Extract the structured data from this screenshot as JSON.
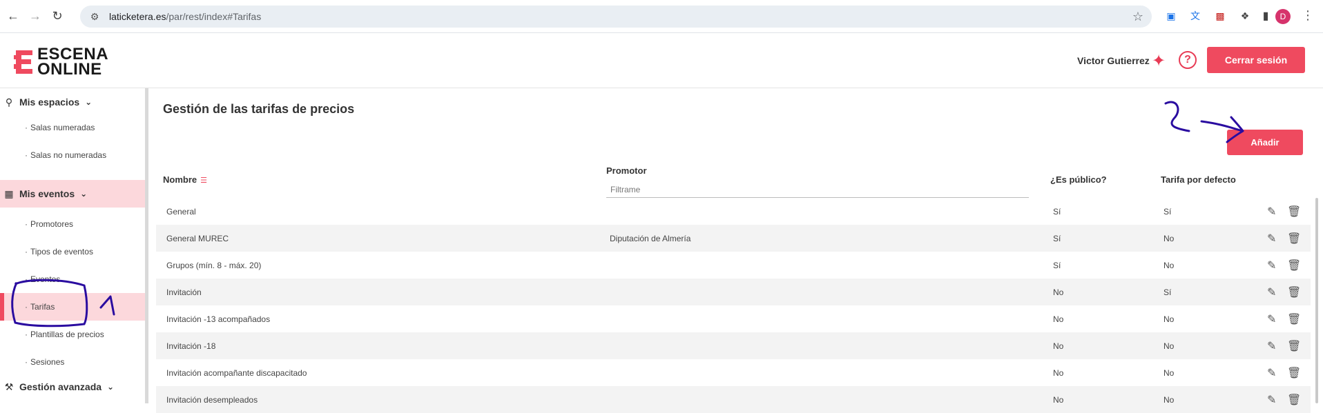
{
  "browser": {
    "url_domain": "laticketera.es",
    "url_path": "/par/rest/index#Tarifas",
    "profile_initial": "D"
  },
  "header": {
    "logo_line1": "ESCENA",
    "logo_line2": "ONLINE",
    "user_name": "Victor Gutierrez",
    "logout_label": "Cerrar sesión",
    "accent_color": "#ef4a5f"
  },
  "sidebar": {
    "sections": [
      {
        "label": "Mis espacios",
        "items": [
          "Salas numeradas",
          "Salas no numeradas"
        ]
      },
      {
        "label": "Mis eventos",
        "items": [
          "Promotores",
          "Tipos de eventos",
          "Eventos",
          "Tarifas",
          "Plantillas de precios",
          "Sesiones"
        ]
      },
      {
        "label": "Gestión avanzada",
        "items": []
      }
    ],
    "selected_item": "Tarifas"
  },
  "main": {
    "title": "Gestión de las tarifas de precios",
    "add_label": "Añadir",
    "columns": {
      "name": "Nombre",
      "promoter": "Promotor",
      "public": "¿Es público?",
      "default": "Tarifa por defecto"
    },
    "filter_placeholder": "Filtrame",
    "rows": [
      {
        "name": "General",
        "promoter": "",
        "public": "Sí",
        "default": "Sí"
      },
      {
        "name": "General MUREC",
        "promoter": "Diputación de Almería",
        "public": "Sí",
        "default": "No"
      },
      {
        "name": "Grupos (mín. 8 - máx. 20)",
        "promoter": "",
        "public": "Sí",
        "default": "No"
      },
      {
        "name": "Invitación",
        "promoter": "",
        "public": "No",
        "default": "Sí"
      },
      {
        "name": "Invitación -13 acompañados",
        "promoter": "",
        "public": "No",
        "default": "No"
      },
      {
        "name": "Invitación -18",
        "promoter": "",
        "public": "No",
        "default": "No"
      },
      {
        "name": "Invitación acompañante discapacitado",
        "promoter": "",
        "public": "No",
        "default": "No"
      },
      {
        "name": "Invitación desempleados",
        "promoter": "",
        "public": "No",
        "default": "No"
      }
    ]
  },
  "annotations": {
    "number_1": "1",
    "number_2": "2",
    "ink_color": "#2a0ca0"
  }
}
